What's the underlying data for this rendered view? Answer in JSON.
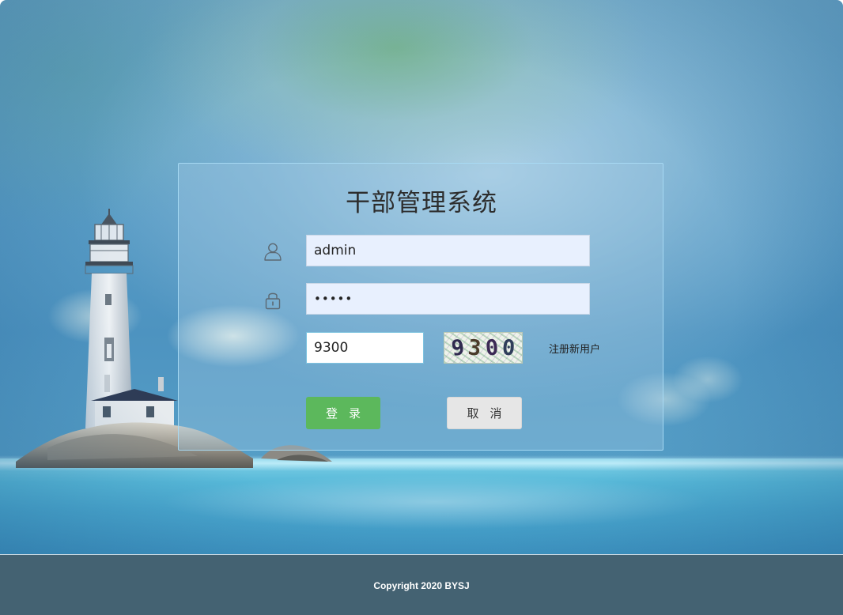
{
  "app": {
    "title": "干部管理系统"
  },
  "login": {
    "username_value": "admin",
    "password_value": "•••••",
    "captcha_value": "9300",
    "captcha_image_text": [
      "9",
      "3",
      "0",
      "0"
    ],
    "register_label": "注册新用户",
    "login_label": "登录",
    "cancel_label": "取消"
  },
  "icons": {
    "username": "user-icon",
    "password": "lock-icon"
  },
  "footer": {
    "copyright": "Copyright 2020 BYSJ"
  },
  "colors": {
    "login_button": "#5cb85c",
    "cancel_button": "#e6e6e6",
    "footer_bg": "#446272",
    "autofill_bg": "#e8f0fe"
  }
}
